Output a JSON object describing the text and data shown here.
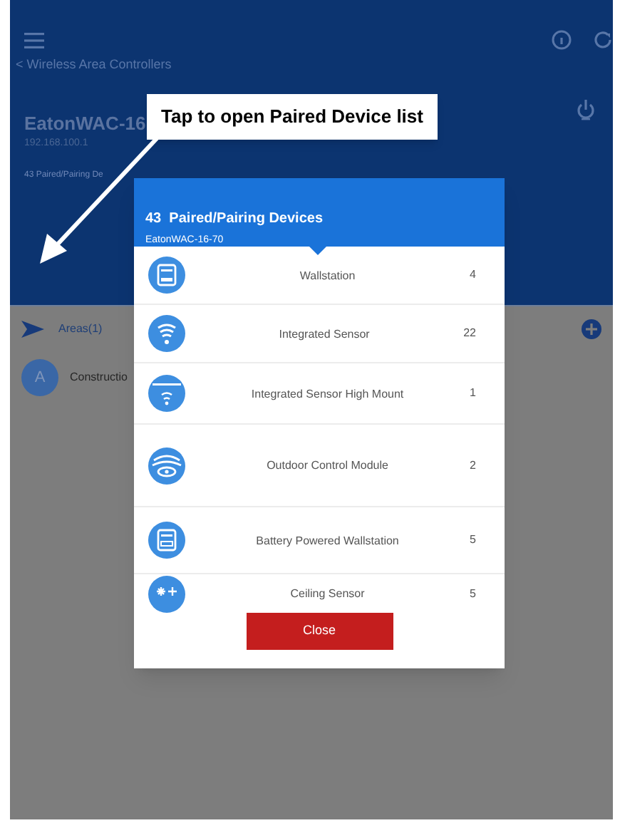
{
  "nav": {
    "back_link": "< Wireless Area Controllers"
  },
  "controller": {
    "name": "EatonWAC-16",
    "ip": "192.168.100.1",
    "paired_summary": "43 Paired/Pairing De"
  },
  "areas": {
    "heading": "Areas(1)",
    "items": [
      {
        "avatar": "A",
        "name": "Constructio"
      }
    ]
  },
  "callout": {
    "text": "Tap to open Paired Device list"
  },
  "dialog": {
    "title": "43  Paired/Pairing Devices",
    "subtitle": "EatonWAC-16-70",
    "devices": [
      {
        "kind": "wallstation",
        "name": "Wallstation",
        "count": "4"
      },
      {
        "kind": "sensor",
        "name": "Integrated Sensor",
        "count": "22"
      },
      {
        "kind": "sensor_high",
        "name": "Integrated Sensor High Mount",
        "count": "1"
      },
      {
        "kind": "outdoor",
        "name": "Outdoor Control Module",
        "count": "2"
      },
      {
        "kind": "battery_wallstation",
        "name": "Battery Powered Wallstation",
        "count": "5"
      },
      {
        "kind": "ceiling",
        "name": "Ceiling Sensor",
        "count": "5"
      }
    ],
    "close": "Close"
  }
}
